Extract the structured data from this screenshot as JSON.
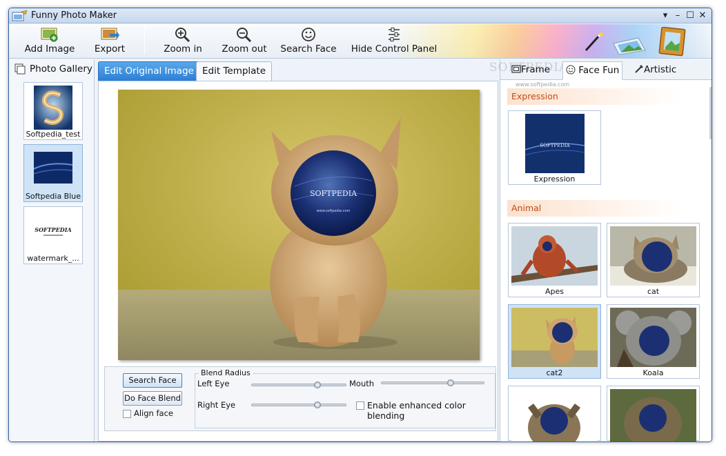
{
  "window": {
    "title": "Funny Photo Maker"
  },
  "toolbar": {
    "add_image": "Add Image",
    "export": "Export",
    "zoom_in": "Zoom in",
    "zoom_out": "Zoom out",
    "search_face": "Search Face",
    "hide_control_panel": "Hide Control Panel"
  },
  "gallery": {
    "title": "Photo Gallery",
    "items": [
      {
        "caption": "Softpedia_test"
      },
      {
        "caption": "Softpedia Blue"
      },
      {
        "caption": "watermark_..."
      }
    ]
  },
  "editor": {
    "tabs": [
      "Edit Original Image",
      "Edit Template"
    ],
    "photo_mask_text": "SOFTPEDIA",
    "photo_mask_url": "www.softpedia.com"
  },
  "controls": {
    "search_face_button": "Search Face",
    "face_blend_button": "Do Face Blend",
    "align_face": "Align face",
    "blend_radius": "Blend Radius",
    "left_eye": "Left Eye",
    "right_eye": "Right Eye",
    "mouth": "Mouth",
    "enhanced_blend": "Enable enhanced color blending",
    "left_eye_value": 0.7,
    "right_eye_value": 0.7,
    "mouth_value": 0.68
  },
  "right_panel": {
    "tabs": [
      "Frame",
      "Face Fun",
      "Artistic"
    ],
    "watermark_top": "SOFTPEDIA",
    "watermark_url": "www.softpedia.com",
    "expression_section": "Expression",
    "expression_items": [
      {
        "caption": "Expression"
      }
    ],
    "animal_section": "Animal",
    "animal_items": [
      {
        "caption": "Apes"
      },
      {
        "caption": "cat"
      },
      {
        "caption": "cat2"
      },
      {
        "caption": "Koala"
      }
    ]
  },
  "colors": {
    "accent_blue": "#2c7fd4",
    "section_orange": "#c24a10",
    "selection": "#cfe3f7"
  }
}
